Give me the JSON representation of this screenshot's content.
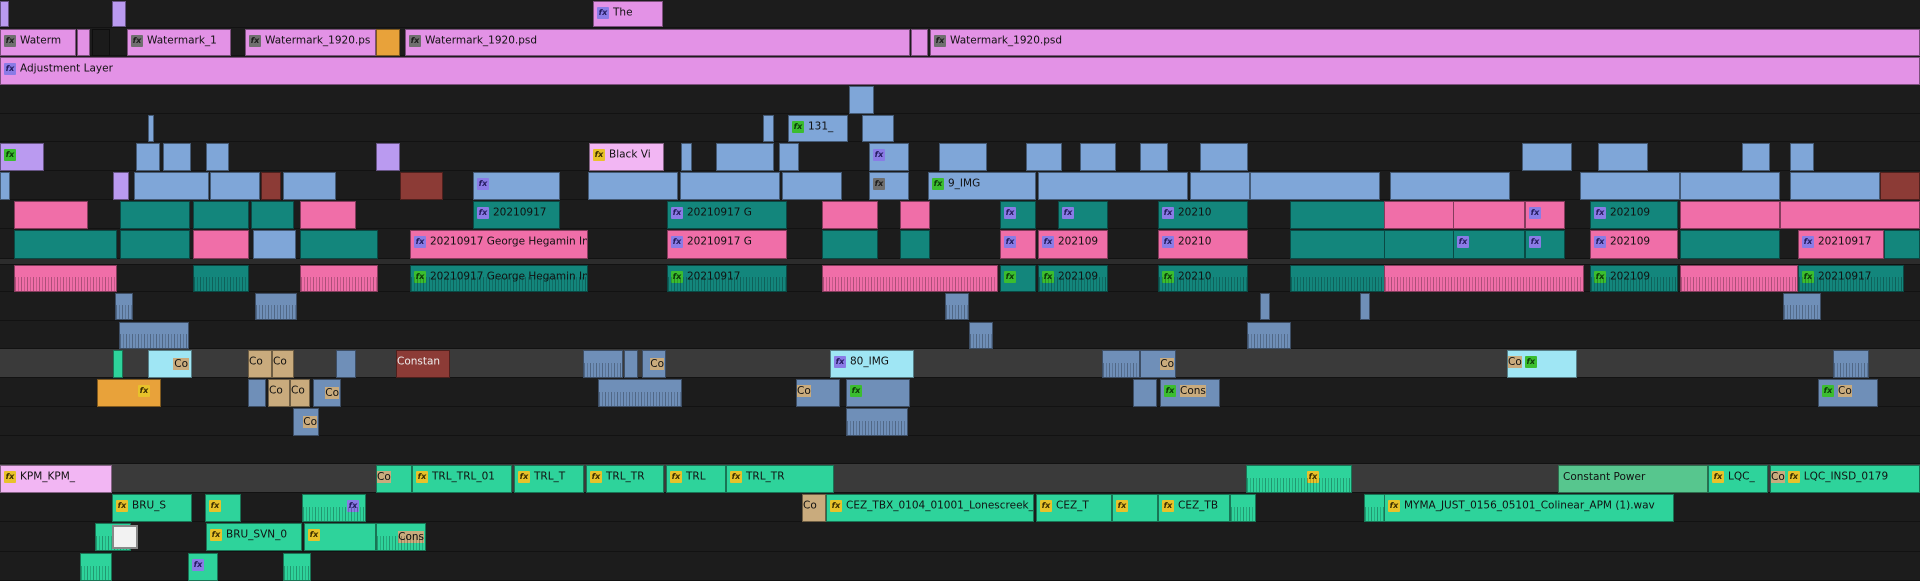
{
  "timeline": {
    "colors": {
      "violet": "#ba9af0",
      "pink_magenta": "#e392e6",
      "light_pink": "#f2b6f3",
      "blue": "#7fa6d8",
      "teal": "#13867c",
      "pink": "#f06ea8",
      "light_cyan": "#9fe6f4",
      "mint": "#2ed39b",
      "green_audio": "#57c68e",
      "orange": "#e8a23a",
      "maroon": "#8c3b36",
      "tan": "#c9ab7d",
      "steel": "#6f8fb8"
    },
    "clip_labels": {
      "the": "The",
      "waterm": "Waterm",
      "watermark_1": "Watermark_1",
      "watermark_1920_ps": "Watermark_1920.ps",
      "watermark_1920_psd_a": "Watermark_1920.psd",
      "watermark_1920_psd_b": "Watermark_1920.psd",
      "adjustment_layer": "Adjustment Layer",
      "clip_131": "131_",
      "black_vi": "Black Vi",
      "img_9": "9_IMG",
      "v_20210917_a": "20210917",
      "v_20210917_g_a": "20210917 G",
      "v_20210": "20210",
      "v_202109_a": "202109",
      "george_hegamin_a": "20210917 George Hegamin Int",
      "v_20210917_g_b": "20210917 G",
      "v_202109_b": "202109",
      "v_20210_b": "20210",
      "v_202109_c": "202109",
      "v_20210917_b": "20210917",
      "george_hegamin_b": "20210917 George Hegamin Int",
      "v_20210917_c": "20210917",
      "v_202109_d": "202109",
      "v_20210_c": "20210",
      "v_202109_e": "202109",
      "v_20210917_d": "20210917",
      "constant": "Constan",
      "co_a": "Co",
      "co_b": "Co",
      "co_c": "Co",
      "co_d": "Co",
      "img_80": "80_IMG",
      "co_e": "Co",
      "co_f": "Co",
      "co_g": "Co",
      "co_h": "Co",
      "co_i": "Co",
      "co_j": "Co",
      "co_k": "Co",
      "cons_a": "Cons",
      "co_l": "Co",
      "kpm_kpm": "KPM_KPM_",
      "co_m": "Co",
      "trl_trl_01": "TRL_TRL_01",
      "trl_t": "TRL_T",
      "trl_tr_a": "TRL_TR",
      "trl": "TRL",
      "trl_tr_b": "TRL_TR",
      "constant_power": "Constant Power",
      "lqc": "LQC_",
      "co_n": "Co",
      "lqc_insd_0179": "LQC_INSD_0179",
      "bru_s": "BRU_S",
      "co_o": "Co",
      "cez_tbx": "CEZ_TBX_0104_01001_Lonescreek_",
      "cez_t": "CEZ_T",
      "cez_tb": "CEZ_TB",
      "myma_just": "MYMA_JUST_0156_05101_Colinear_APM (1).wav",
      "bru_svn_0": "BRU_SVN_0",
      "cons_b": "Cons"
    }
  }
}
